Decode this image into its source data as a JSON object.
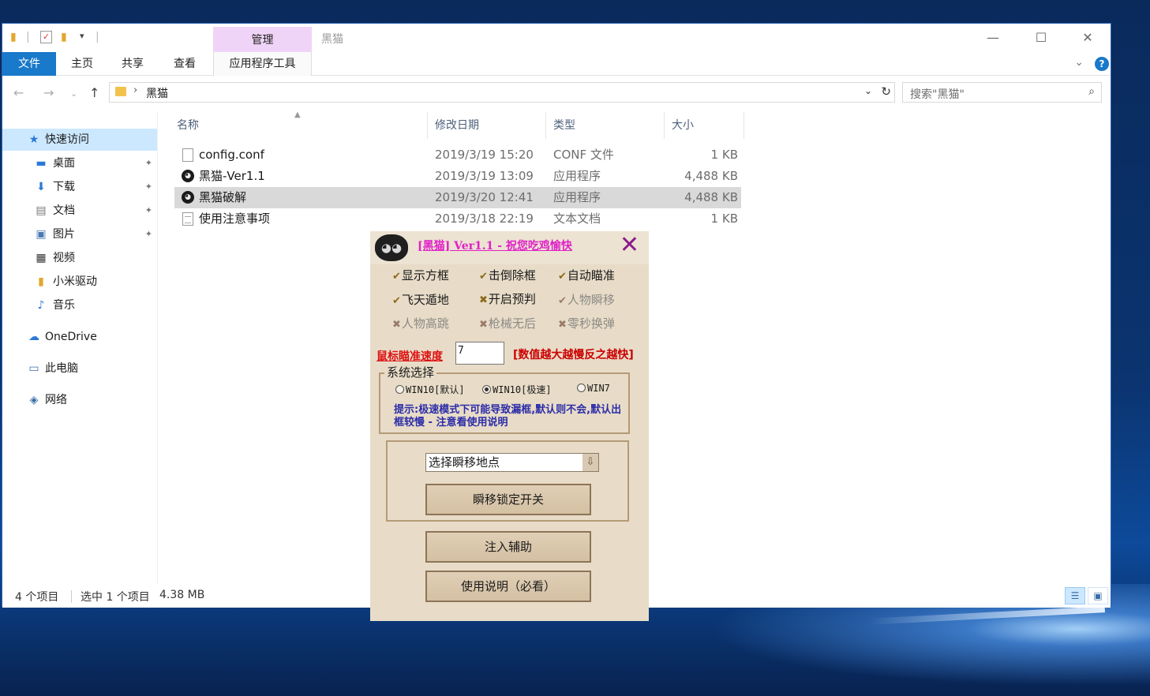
{
  "window": {
    "title": "黑猫",
    "contextual_tab": "管理",
    "controls": {
      "minimize": "—",
      "maximize": "☐",
      "close": "✕"
    }
  },
  "ribbon": {
    "tabs": [
      "文件",
      "主页",
      "共享",
      "查看",
      "应用程序工具"
    ],
    "help": "?"
  },
  "navigation": {
    "path_segment": "黑猫",
    "search_placeholder": "搜索\"黑猫\""
  },
  "sidebar": {
    "quick_access": "快速访问",
    "items": [
      "桌面",
      "下载",
      "文档",
      "图片",
      "视频",
      "小米驱动",
      "音乐"
    ],
    "onedrive": "OneDrive",
    "this_pc": "此电脑",
    "network": "网络"
  },
  "columns": {
    "name": "名称",
    "date": "修改日期",
    "type": "类型",
    "size": "大小"
  },
  "files": [
    {
      "name": "config.conf",
      "date": "2019/3/19 15:20",
      "type": "CONF 文件",
      "size": "1 KB"
    },
    {
      "name": "黑猫-Ver1.1",
      "date": "2019/3/19 13:09",
      "type": "应用程序",
      "size": "4,488 KB"
    },
    {
      "name": "黑猫破解",
      "date": "2019/3/20 12:41",
      "type": "应用程序",
      "size": "4,488 KB"
    },
    {
      "name": "使用注意事项",
      "date": "2019/3/18 22:19",
      "type": "文本文档",
      "size": "1 KB"
    }
  ],
  "status": {
    "count": "4 个项目",
    "selection": "选中 1 个项目",
    "size": "4.38 MB"
  },
  "tool": {
    "title": "[黑猫] Ver1.1 - 祝您吃鸡愉快",
    "close": "✕",
    "options": [
      {
        "label": "显示方框",
        "checked": true
      },
      {
        "label": "击倒除框",
        "checked": true
      },
      {
        "label": "自动瞄准",
        "checked": true
      },
      {
        "label": "飞天遁地",
        "checked": true
      },
      {
        "label": "开启预判",
        "checked": false
      },
      {
        "label": "人物瞬移",
        "checked": true
      },
      {
        "label": "人物高跳",
        "checked": false
      },
      {
        "label": "枪械无后",
        "checked": false
      },
      {
        "label": "零秒换弹",
        "checked": false
      }
    ],
    "speed_label": "鼠标瞄准速度",
    "speed_value": "7",
    "speed_hint": "[数值越大越慢反之越快]",
    "system_group": "系统选择",
    "radios": [
      "WIN10[默认]",
      "WIN10[极速]",
      "WIN7"
    ],
    "radio_selected": "WIN10[极速]",
    "tip": "提示:极速模式下可能导致漏框,默认则不会,默认出框较慢 - 注意看使用说明",
    "teleport_select": "选择瞬移地点",
    "lock_button": "瞬移锁定开关",
    "inject_button": "注入辅助",
    "manual_button": "使用说明（必看）"
  },
  "colors": {
    "accent": "#1979ca",
    "manage_tab": "#f0d4f7",
    "selected_row": "#d9d9d9",
    "tool_bg": "#e8dcc8",
    "tool_title": "#e020c8",
    "speed_red": "#dd1111",
    "tip_blue": "#2c2ca8"
  }
}
